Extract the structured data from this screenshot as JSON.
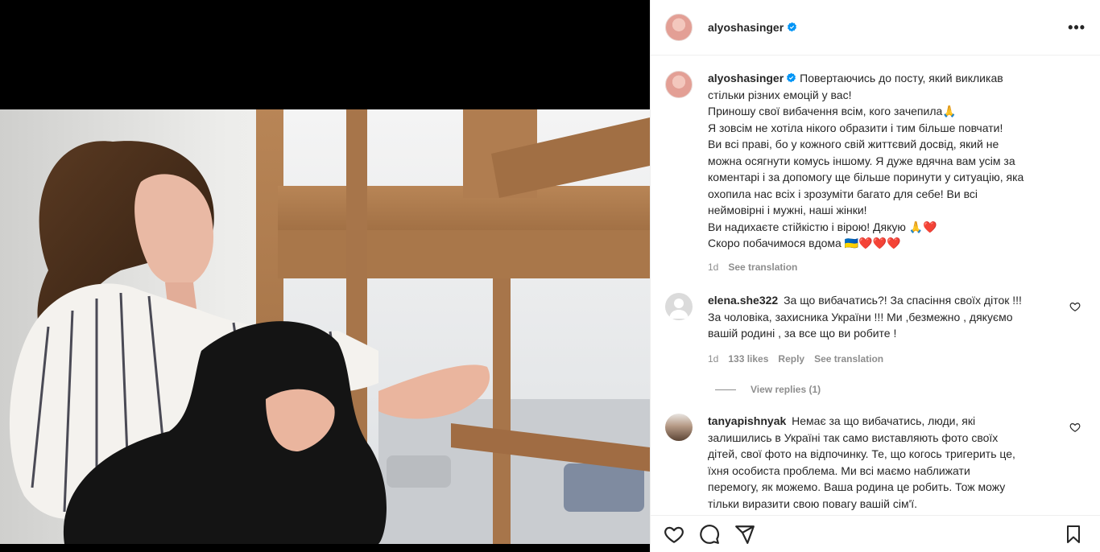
{
  "post": {
    "author": "alyoshasinger",
    "verified": true,
    "more_icon": "more-horizontal-icon"
  },
  "caption": {
    "author": "alyoshasinger",
    "lines": [
      "Повертаючись до посту, який викликав",
      "стільки різних емоцій у вас!",
      "Приношу свої вибачення всім, кого зачепила🙏",
      "Я зовсім не хотіла нікого образити і тим більше повчати!",
      "Ви всі праві, бо у кожного свій життєвий досвід, який не",
      "можна осягнути комусь іншому. Я дуже вдячна вам усім за",
      "коментарі і за допомогу ще більше поринути у ситуацію, яка",
      "охопила нас всіх і зрозуміти багато для себе! Ви всі",
      "неймовірні і мужні, наші жінки!",
      "Ви надихаєте стійкістю і вірою! Дякую 🙏❤️",
      "Скоро побачимося вдома 🇺🇦❤️❤️❤️"
    ],
    "time": "1d",
    "see_translation": "See translation"
  },
  "comments": [
    {
      "user": "elena.she322",
      "lines": [
        "За що вибачатись?! За спасіння своїх діток !!!",
        "За чоловіка, захисника України !!! Ми ,безмежно , дякуємо",
        "вашій родині , за все що ви робите !"
      ],
      "time": "1d",
      "likes": "133 likes",
      "reply": "Reply",
      "see_translation": "See translation",
      "view_replies": "View replies (1)"
    },
    {
      "user": "tanyapishnyak",
      "lines": [
        "Немає за що вибачатись, люди, які",
        "залишились в Україні так само виставляють фото своїх",
        "дітей, свої фото на відпочинку. Те, що когось тригерить це,",
        "їхня особиста проблема. Ми всі маємо наближати",
        "перемогу, як можемо. Ваша родина це робить. Тож можу",
        "тільки виразити свою повагу вашій сім'ї."
      ]
    }
  ],
  "actions": {
    "like_icon": "heart-icon",
    "comment_icon": "comment-icon",
    "share_icon": "share-icon",
    "save_icon": "bookmark-icon"
  },
  "colors": {
    "text": "#262626",
    "secondary": "#8e8e8e",
    "verified": "#0095f6",
    "border": "#efefef"
  }
}
